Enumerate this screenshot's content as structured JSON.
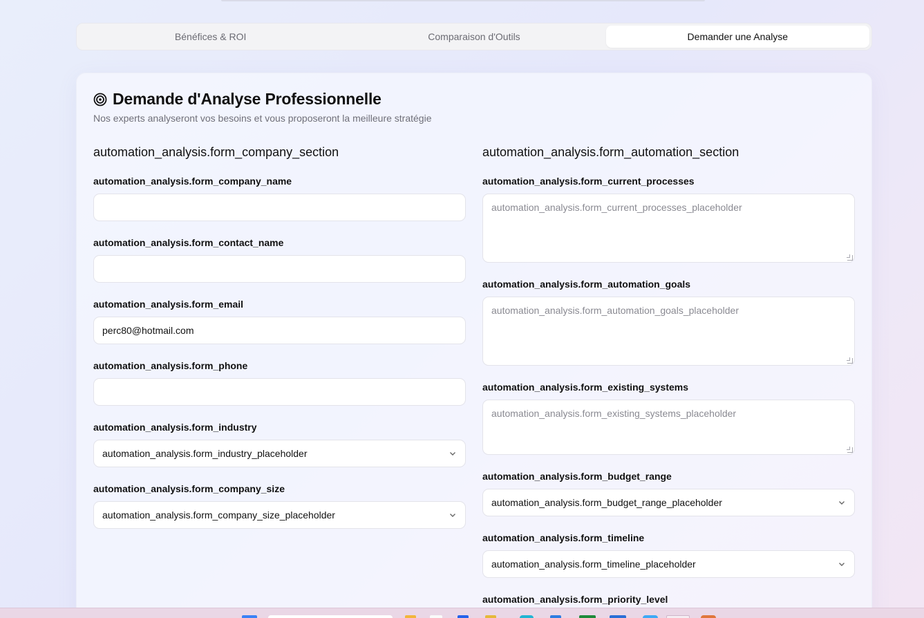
{
  "tabs": [
    {
      "label": "Bénéfices & ROI",
      "active": false
    },
    {
      "label": "Comparaison d'Outils",
      "active": false
    },
    {
      "label": "Demander une Analyse",
      "active": true
    }
  ],
  "card": {
    "icon": "target-icon",
    "title": "Demande d'Analyse Professionnelle",
    "subtitle": "Nos experts analyseront vos besoins et vous proposeront la meilleure stratégie"
  },
  "company_section": {
    "title": "automation_analysis.form_company_section",
    "company_name": {
      "label": "automation_analysis.form_company_name",
      "value": ""
    },
    "contact_name": {
      "label": "automation_analysis.form_contact_name",
      "value": ""
    },
    "email": {
      "label": "automation_analysis.form_email",
      "value": "perc80@hotmail.com"
    },
    "phone": {
      "label": "automation_analysis.form_phone",
      "value": ""
    },
    "industry": {
      "label": "automation_analysis.form_industry",
      "selected": "automation_analysis.form_industry_placeholder"
    },
    "company_size": {
      "label": "automation_analysis.form_company_size",
      "selected": "automation_analysis.form_company_size_placeholder"
    }
  },
  "automation_section": {
    "title": "automation_analysis.form_automation_section",
    "current_processes": {
      "label": "automation_analysis.form_current_processes",
      "placeholder": "automation_analysis.form_current_processes_placeholder"
    },
    "automation_goals": {
      "label": "automation_analysis.form_automation_goals",
      "placeholder": "automation_analysis.form_automation_goals_placeholder"
    },
    "existing_systems": {
      "label": "automation_analysis.form_existing_systems",
      "placeholder": "automation_analysis.form_existing_systems_placeholder"
    },
    "budget_range": {
      "label": "automation_analysis.form_budget_range",
      "selected": "automation_analysis.form_budget_range_placeholder"
    },
    "timeline": {
      "label": "automation_analysis.form_timeline",
      "selected": "automation_analysis.form_timeline_placeholder"
    },
    "priority_level": {
      "label": "automation_analysis.form_priority_level"
    }
  },
  "icons": {
    "select": "chevron-down-icon",
    "title": "target-icon"
  }
}
